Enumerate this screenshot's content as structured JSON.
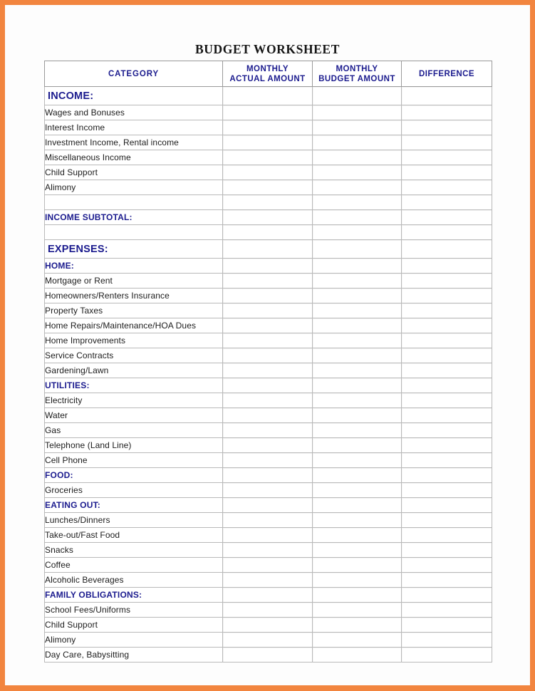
{
  "document": {
    "title": "BUDGET WORKSHEET",
    "accent_color": "#f2853f",
    "header_text_color": "#1b1b8e"
  },
  "table": {
    "columns": [
      {
        "key": "category",
        "label": "CATEGORY"
      },
      {
        "key": "actual",
        "label": "MONTHLY ACTUAL AMOUNT",
        "line1": "MONTHLY",
        "line2": "ACTUAL AMOUNT"
      },
      {
        "key": "budget",
        "label": "MONTHLY BUDGET AMOUNT",
        "line1": "MONTHLY",
        "line2": "BUDGET AMOUNT"
      },
      {
        "key": "difference",
        "label": "DIFFERENCE",
        "line1": "DIFFERENCE",
        "line2": ""
      }
    ],
    "rows": [
      {
        "type": "section",
        "label": "INCOME:",
        "actual": "",
        "budget": "",
        "difference": ""
      },
      {
        "type": "item",
        "label": "Wages and Bonuses",
        "actual": "",
        "budget": "",
        "difference": ""
      },
      {
        "type": "item",
        "label": "Interest Income",
        "actual": "",
        "budget": "",
        "difference": ""
      },
      {
        "type": "item",
        "label": "Investment Income, Rental income",
        "actual": "",
        "budget": "",
        "difference": ""
      },
      {
        "type": "item",
        "label": "Miscellaneous Income",
        "actual": "",
        "budget": "",
        "difference": ""
      },
      {
        "type": "item",
        "label": "Child Support",
        "actual": "",
        "budget": "",
        "difference": ""
      },
      {
        "type": "item",
        "label": "Alimony",
        "actual": "",
        "budget": "",
        "difference": ""
      },
      {
        "type": "blank",
        "label": "",
        "actual": "",
        "budget": "",
        "difference": ""
      },
      {
        "type": "subsection",
        "label": "INCOME SUBTOTAL:",
        "actual": "",
        "budget": "",
        "difference": ""
      },
      {
        "type": "blank",
        "label": "",
        "actual": "",
        "budget": "",
        "difference": ""
      },
      {
        "type": "section",
        "label": "EXPENSES:",
        "actual": "",
        "budget": "",
        "difference": ""
      },
      {
        "type": "subsection",
        "label": "HOME:",
        "actual": "",
        "budget": "",
        "difference": ""
      },
      {
        "type": "item",
        "label": "Mortgage or Rent",
        "actual": "",
        "budget": "",
        "difference": ""
      },
      {
        "type": "item",
        "label": "Homeowners/Renters Insurance",
        "actual": "",
        "budget": "",
        "difference": ""
      },
      {
        "type": "item",
        "label": "Property Taxes",
        "actual": "",
        "budget": "",
        "difference": ""
      },
      {
        "type": "item",
        "label": "Home Repairs/Maintenance/HOA Dues",
        "actual": "",
        "budget": "",
        "difference": ""
      },
      {
        "type": "item",
        "label": "Home Improvements",
        "actual": "",
        "budget": "",
        "difference": ""
      },
      {
        "type": "item",
        "label": "Service Contracts",
        "actual": "",
        "budget": "",
        "difference": ""
      },
      {
        "type": "item",
        "label": "Gardening/Lawn",
        "actual": "",
        "budget": "",
        "difference": ""
      },
      {
        "type": "subsection",
        "label": "UTILITIES:",
        "actual": "",
        "budget": "",
        "difference": ""
      },
      {
        "type": "item",
        "label": "Electricity",
        "actual": "",
        "budget": "",
        "difference": ""
      },
      {
        "type": "item",
        "label": "Water",
        "actual": "",
        "budget": "",
        "difference": ""
      },
      {
        "type": "item",
        "label": "Gas",
        "actual": "",
        "budget": "",
        "difference": ""
      },
      {
        "type": "item",
        "label": "Telephone (Land Line)",
        "actual": "",
        "budget": "",
        "difference": ""
      },
      {
        "type": "item",
        "label": "Cell Phone",
        "actual": "",
        "budget": "",
        "difference": ""
      },
      {
        "type": "subsection",
        "label": "FOOD:",
        "actual": "",
        "budget": "",
        "difference": ""
      },
      {
        "type": "item",
        "label": "Groceries",
        "actual": "",
        "budget": "",
        "difference": ""
      },
      {
        "type": "subsection",
        "label": "EATING OUT:",
        "actual": "",
        "budget": "",
        "difference": ""
      },
      {
        "type": "item",
        "label": "Lunches/Dinners",
        "actual": "",
        "budget": "",
        "difference": ""
      },
      {
        "type": "item",
        "label": "Take-out/Fast Food",
        "actual": "",
        "budget": "",
        "difference": ""
      },
      {
        "type": "item",
        "label": "Snacks",
        "actual": "",
        "budget": "",
        "difference": ""
      },
      {
        "type": "item",
        "label": "Coffee",
        "actual": "",
        "budget": "",
        "difference": ""
      },
      {
        "type": "item",
        "label": "Alcoholic Beverages",
        "actual": "",
        "budget": "",
        "difference": ""
      },
      {
        "type": "subsection",
        "label": "FAMILY OBLIGATIONS:",
        "actual": "",
        "budget": "",
        "difference": ""
      },
      {
        "type": "item",
        "label": "School Fees/Uniforms",
        "actual": "",
        "budget": "",
        "difference": ""
      },
      {
        "type": "item",
        "label": "Child Support",
        "actual": "",
        "budget": "",
        "difference": ""
      },
      {
        "type": "item",
        "label": "Alimony",
        "actual": "",
        "budget": "",
        "difference": ""
      },
      {
        "type": "item",
        "label": "Day Care, Babysitting",
        "actual": "",
        "budget": "",
        "difference": ""
      }
    ]
  }
}
